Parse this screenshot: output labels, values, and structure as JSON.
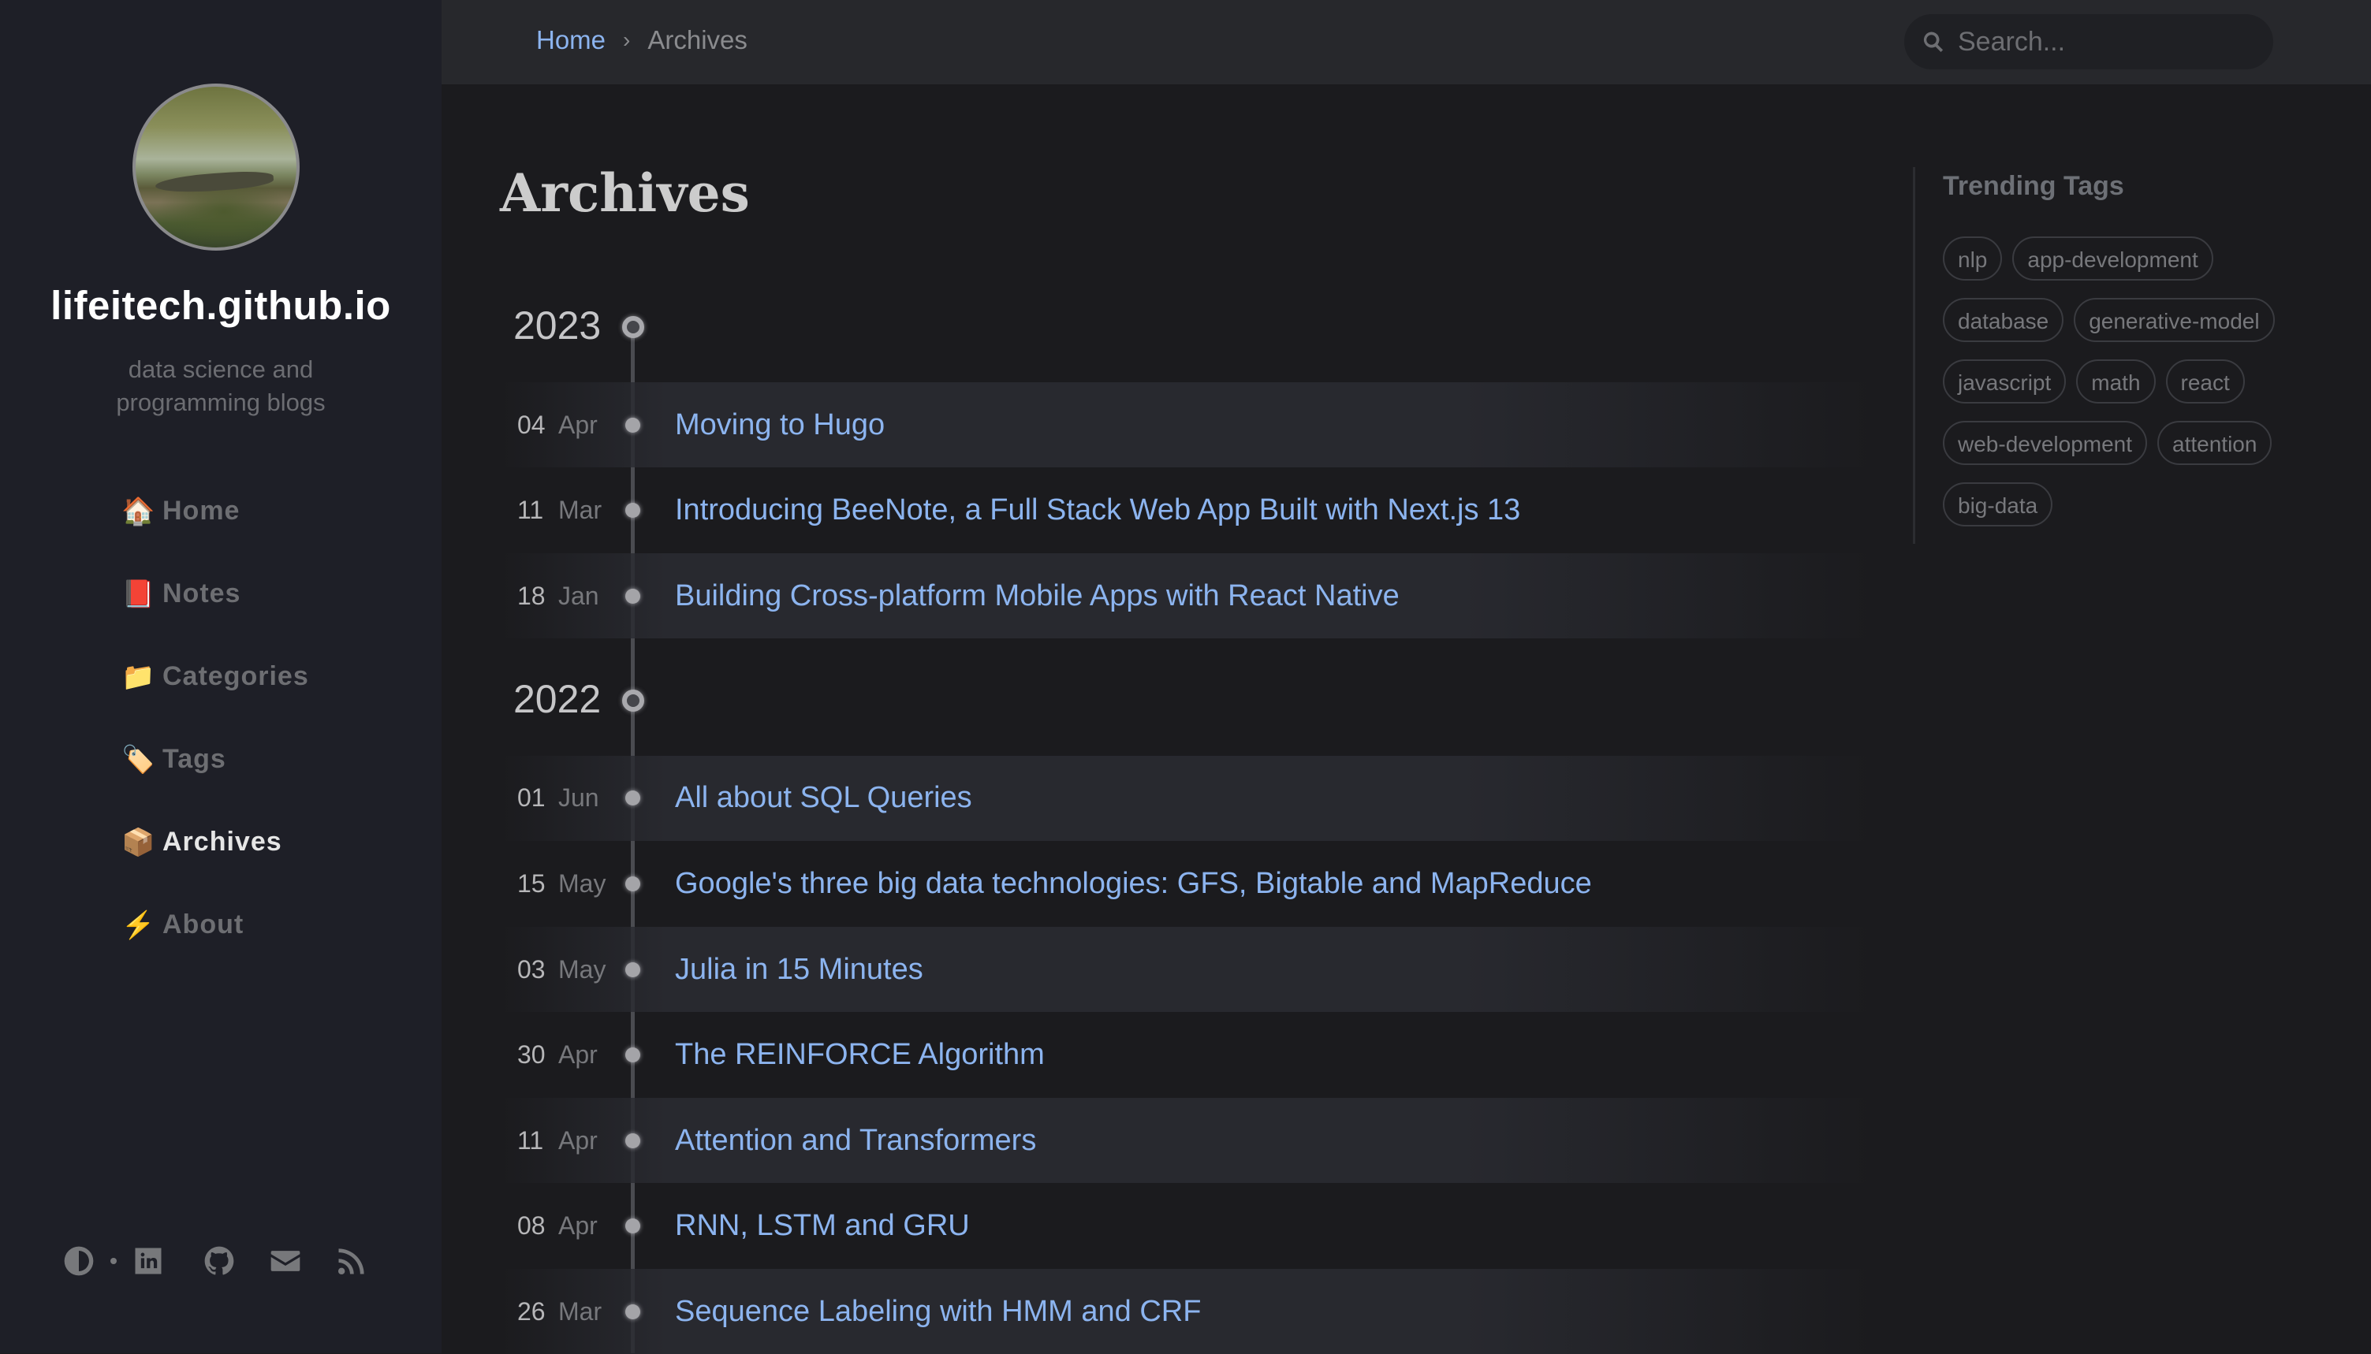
{
  "sidebar": {
    "site_title": "lifeitech.github.io",
    "site_subtitle_line1": "data science and",
    "site_subtitle_line2": "programming blogs",
    "nav": [
      {
        "emoji": "🏠",
        "label": "Home",
        "icon": "house-icon"
      },
      {
        "emoji": "📕",
        "label": "Notes",
        "icon": "book-icon"
      },
      {
        "emoji": "📁",
        "label": "Categories",
        "icon": "folder-icon"
      },
      {
        "emoji": "🏷️",
        "label": "Tags",
        "icon": "tag-icon"
      },
      {
        "emoji": "📦",
        "label": "Archives",
        "icon": "package-icon",
        "active": true
      },
      {
        "emoji": "⚡",
        "label": "About",
        "icon": "lightning-icon"
      }
    ],
    "social_icons": [
      "theme-toggle-icon",
      "linkedin-icon",
      "github-icon",
      "email-icon",
      "rss-icon"
    ]
  },
  "topbar": {
    "breadcrumb": {
      "home": "Home",
      "separator": "›",
      "current": "Archives"
    },
    "search_placeholder": "Search..."
  },
  "main": {
    "title": "Archives",
    "years": [
      {
        "year": "2023",
        "posts": [
          {
            "day": "04",
            "month": "Apr",
            "title": "Moving to Hugo"
          },
          {
            "day": "11",
            "month": "Mar",
            "title": "Introducing BeeNote, a Full Stack Web App Built with Next.js 13"
          },
          {
            "day": "18",
            "month": "Jan",
            "title": "Building Cross-platform Mobile Apps with React Native"
          }
        ]
      },
      {
        "year": "2022",
        "posts": [
          {
            "day": "01",
            "month": "Jun",
            "title": "All about SQL Queries"
          },
          {
            "day": "15",
            "month": "May",
            "title": "Google's three big data technologies: GFS, Bigtable and MapReduce"
          },
          {
            "day": "03",
            "month": "May",
            "title": "Julia in 15 Minutes"
          },
          {
            "day": "30",
            "month": "Apr",
            "title": "The REINFORCE Algorithm"
          },
          {
            "day": "11",
            "month": "Apr",
            "title": "Attention and Transformers"
          },
          {
            "day": "08",
            "month": "Apr",
            "title": "RNN, LSTM and GRU"
          },
          {
            "day": "26",
            "month": "Mar",
            "title": "Sequence Labeling with HMM and CRF"
          }
        ]
      }
    ]
  },
  "trending": {
    "title": "Trending Tags",
    "tags": [
      "nlp",
      "app-development",
      "database",
      "generative-model",
      "javascript",
      "math",
      "react",
      "web-development",
      "attention",
      "big-data"
    ]
  },
  "colors": {
    "link": "#8cb4ef",
    "sidebar_bg": "#1e1f27",
    "topbar_bg": "#27282c",
    "main_bg": "#1b1b1e"
  }
}
